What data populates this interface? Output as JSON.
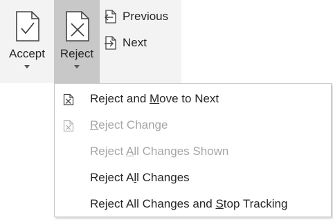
{
  "ribbon": {
    "accept": {
      "label": "Accept",
      "icon": "document-check-icon"
    },
    "reject": {
      "label": "Reject",
      "icon": "document-x-icon",
      "state": "pressed"
    },
    "previous": {
      "label": "Previous",
      "icon": "previous-change-icon"
    },
    "next": {
      "label": "Next",
      "icon": "next-change-icon"
    }
  },
  "menu": {
    "items": [
      {
        "before": "Reject and ",
        "accel": "M",
        "after": "ove to Next",
        "enabled": true,
        "icon": "reject-move-next-icon"
      },
      {
        "before": "",
        "accel": "R",
        "after": "eject Change",
        "enabled": false,
        "icon": "reject-change-icon"
      },
      {
        "before": "Reject ",
        "accel": "A",
        "after": "ll Changes Shown",
        "enabled": false,
        "icon": ""
      },
      {
        "before": "Reject A",
        "accel": "l",
        "after": "l Changes",
        "enabled": true,
        "icon": ""
      },
      {
        "before": "Reject All Changes and ",
        "accel": "S",
        "after": "top Tracking",
        "enabled": true,
        "icon": ""
      }
    ]
  },
  "colors": {
    "ribbon_bg": "#f3f3f3",
    "pressed_bg": "#c8c8c8",
    "text": "#262626",
    "disabled_text": "#a6a6a6",
    "menu_border": "#c6c6c6"
  }
}
